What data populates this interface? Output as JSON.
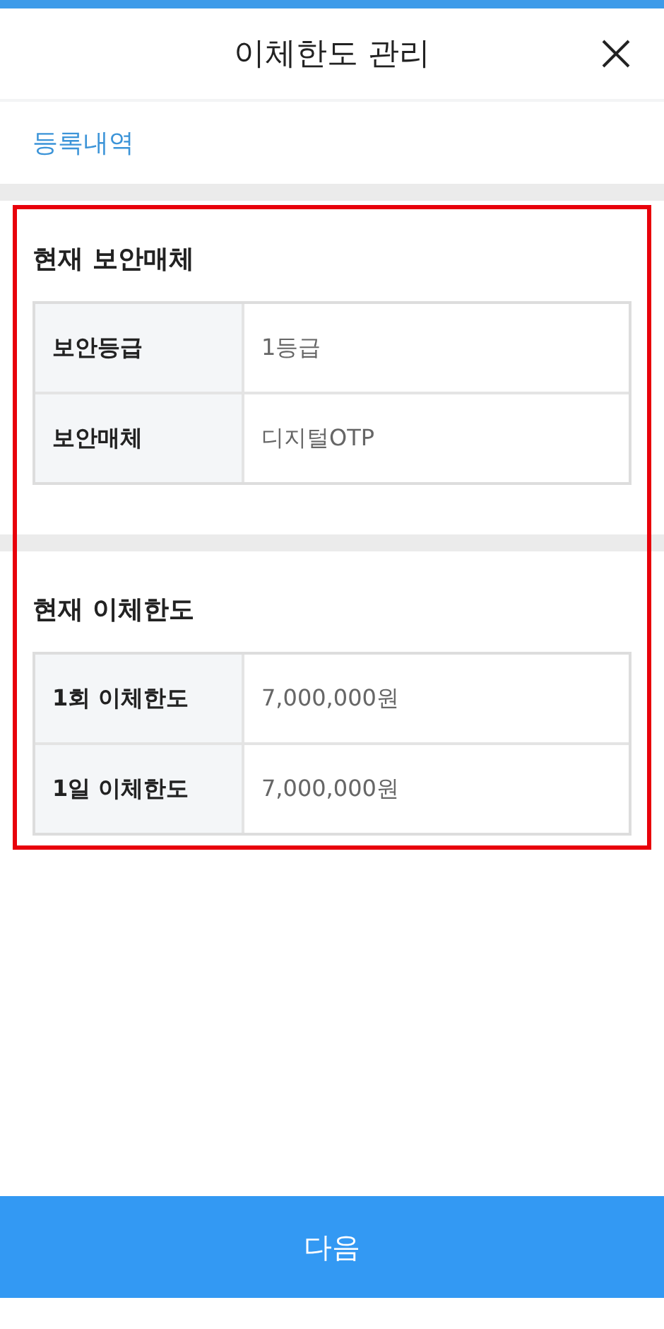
{
  "header": {
    "title": "이체한도 관리"
  },
  "link": {
    "label": "등록내역"
  },
  "sections": [
    {
      "title": "현재 보안매체",
      "rows": [
        {
          "label": "보안등급",
          "value": "1등급"
        },
        {
          "label": "보안매체",
          "value": "디지털OTP"
        }
      ]
    },
    {
      "title": "현재 이체한도",
      "rows": [
        {
          "label": "1회 이체한도",
          "value": "7,000,000원"
        },
        {
          "label": "1일 이체한도",
          "value": "7,000,000원"
        }
      ]
    }
  ],
  "button": {
    "label": "다음"
  }
}
